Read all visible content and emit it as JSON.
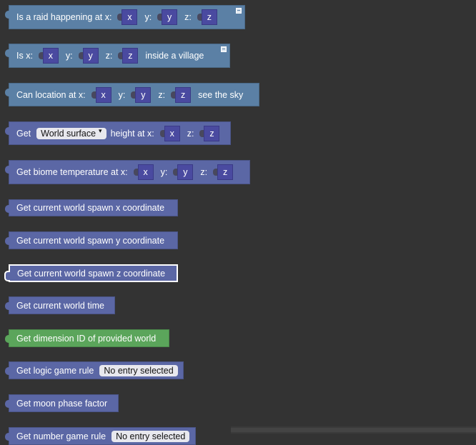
{
  "blocks": [
    {
      "id": "raid",
      "parts": [
        {
          "t": "Is a raid happening at x:"
        },
        {
          "s": "x"
        },
        {
          "t": "y:"
        },
        {
          "s": "y"
        },
        {
          "t": "z:"
        },
        {
          "s": "z"
        }
      ],
      "mutator": true
    },
    {
      "id": "village",
      "parts": [
        {
          "t": "Is x:"
        },
        {
          "s": "x"
        },
        {
          "t": "y:"
        },
        {
          "s": "y"
        },
        {
          "t": "z:"
        },
        {
          "s": "z"
        },
        {
          "t": "inside a village"
        }
      ],
      "mutator": true
    },
    {
      "id": "sky",
      "parts": [
        {
          "t": "Can location at x:"
        },
        {
          "s": "x"
        },
        {
          "t": "y:"
        },
        {
          "s": "y"
        },
        {
          "t": "z:"
        },
        {
          "s": "z"
        },
        {
          "t": "see the sky"
        }
      ]
    },
    {
      "id": "height",
      "parts": [
        {
          "t": "Get"
        },
        {
          "d": "World surface"
        },
        {
          "t": "height at x:"
        },
        {
          "s": "x"
        },
        {
          "t": "z:"
        },
        {
          "s": "z"
        }
      ]
    },
    {
      "id": "biome",
      "parts": [
        {
          "t": "Get biome temperature at x:"
        },
        {
          "s": "x"
        },
        {
          "t": "y:"
        },
        {
          "s": "y"
        },
        {
          "t": "z:"
        },
        {
          "s": "z"
        }
      ]
    },
    {
      "id": "spawnx",
      "parts": [
        {
          "t": "Get current world spawn x coordinate"
        }
      ]
    },
    {
      "id": "spawny",
      "parts": [
        {
          "t": "Get current world spawn y coordinate"
        }
      ]
    },
    {
      "id": "spawnz",
      "parts": [
        {
          "t": "Get current world spawn z coordinate"
        }
      ]
    },
    {
      "id": "time",
      "parts": [
        {
          "t": "Get current world time"
        }
      ]
    },
    {
      "id": "dimension",
      "parts": [
        {
          "t": "Get dimension ID of provided world"
        }
      ]
    },
    {
      "id": "logic",
      "parts": [
        {
          "t": "Get logic game rule"
        },
        {
          "d": "No entry selected",
          "noarrow": true
        }
      ]
    },
    {
      "id": "moon",
      "parts": [
        {
          "t": "Get moon phase factor"
        }
      ]
    },
    {
      "id": "number",
      "parts": [
        {
          "t": "Get number game rule"
        },
        {
          "d": "No entry selected",
          "noarrow": true
        }
      ]
    }
  ],
  "icons": {
    "dropdown_arrow": "▾",
    "mutator": "gear-icon"
  },
  "colors": {
    "background": "#333333",
    "logic_block": "#5b80a5",
    "world_block": "#5b67a5",
    "dimension_block": "#5ba55b",
    "selected_outline": "#ffffff"
  }
}
